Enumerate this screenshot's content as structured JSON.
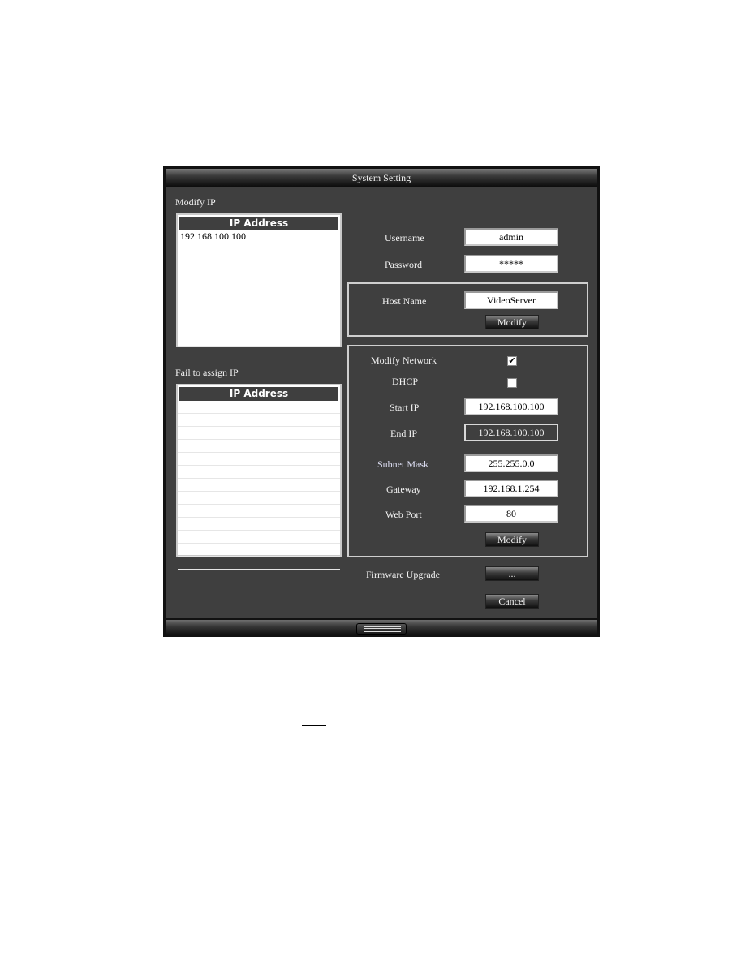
{
  "window": {
    "title": "System Setting"
  },
  "modify_ip": {
    "label": "Modify IP",
    "column_header": "IP Address",
    "rows": [
      "192.168.100.100",
      "",
      "",
      "",
      "",
      "",
      "",
      "",
      ""
    ]
  },
  "fail_ip": {
    "label": "Fail to assign IP",
    "column_header": "IP Address",
    "rows": [
      "",
      "",
      "",
      "",
      "",
      "",
      "",
      "",
      "",
      "",
      "",
      "",
      ""
    ]
  },
  "credentials": {
    "username_label": "Username",
    "username_value": "admin",
    "password_label": "Password",
    "password_value": "*****"
  },
  "host": {
    "label": "Host Name",
    "value": "VideoServer",
    "modify_label": "Modify"
  },
  "network": {
    "modify_network_label": "Modify Network",
    "modify_network_checked": true,
    "dhcp_label": "DHCP",
    "dhcp_checked": false,
    "start_ip_label": "Start IP",
    "start_ip_value": "192.168.100.100",
    "end_ip_label": "End IP",
    "end_ip_value": "192.168.100.100",
    "subnet_label": "Subnet Mask",
    "subnet_value": "255.255.0.0",
    "gateway_label": "Gateway",
    "gateway_value": "192.168.1.254",
    "web_port_label": "Web Port",
    "web_port_value": "80",
    "modify_label": "Modify"
  },
  "firmware": {
    "label": "Firmware Upgrade",
    "browse_label": "..."
  },
  "cancel_label": "Cancel",
  "check_glyph": "✔"
}
